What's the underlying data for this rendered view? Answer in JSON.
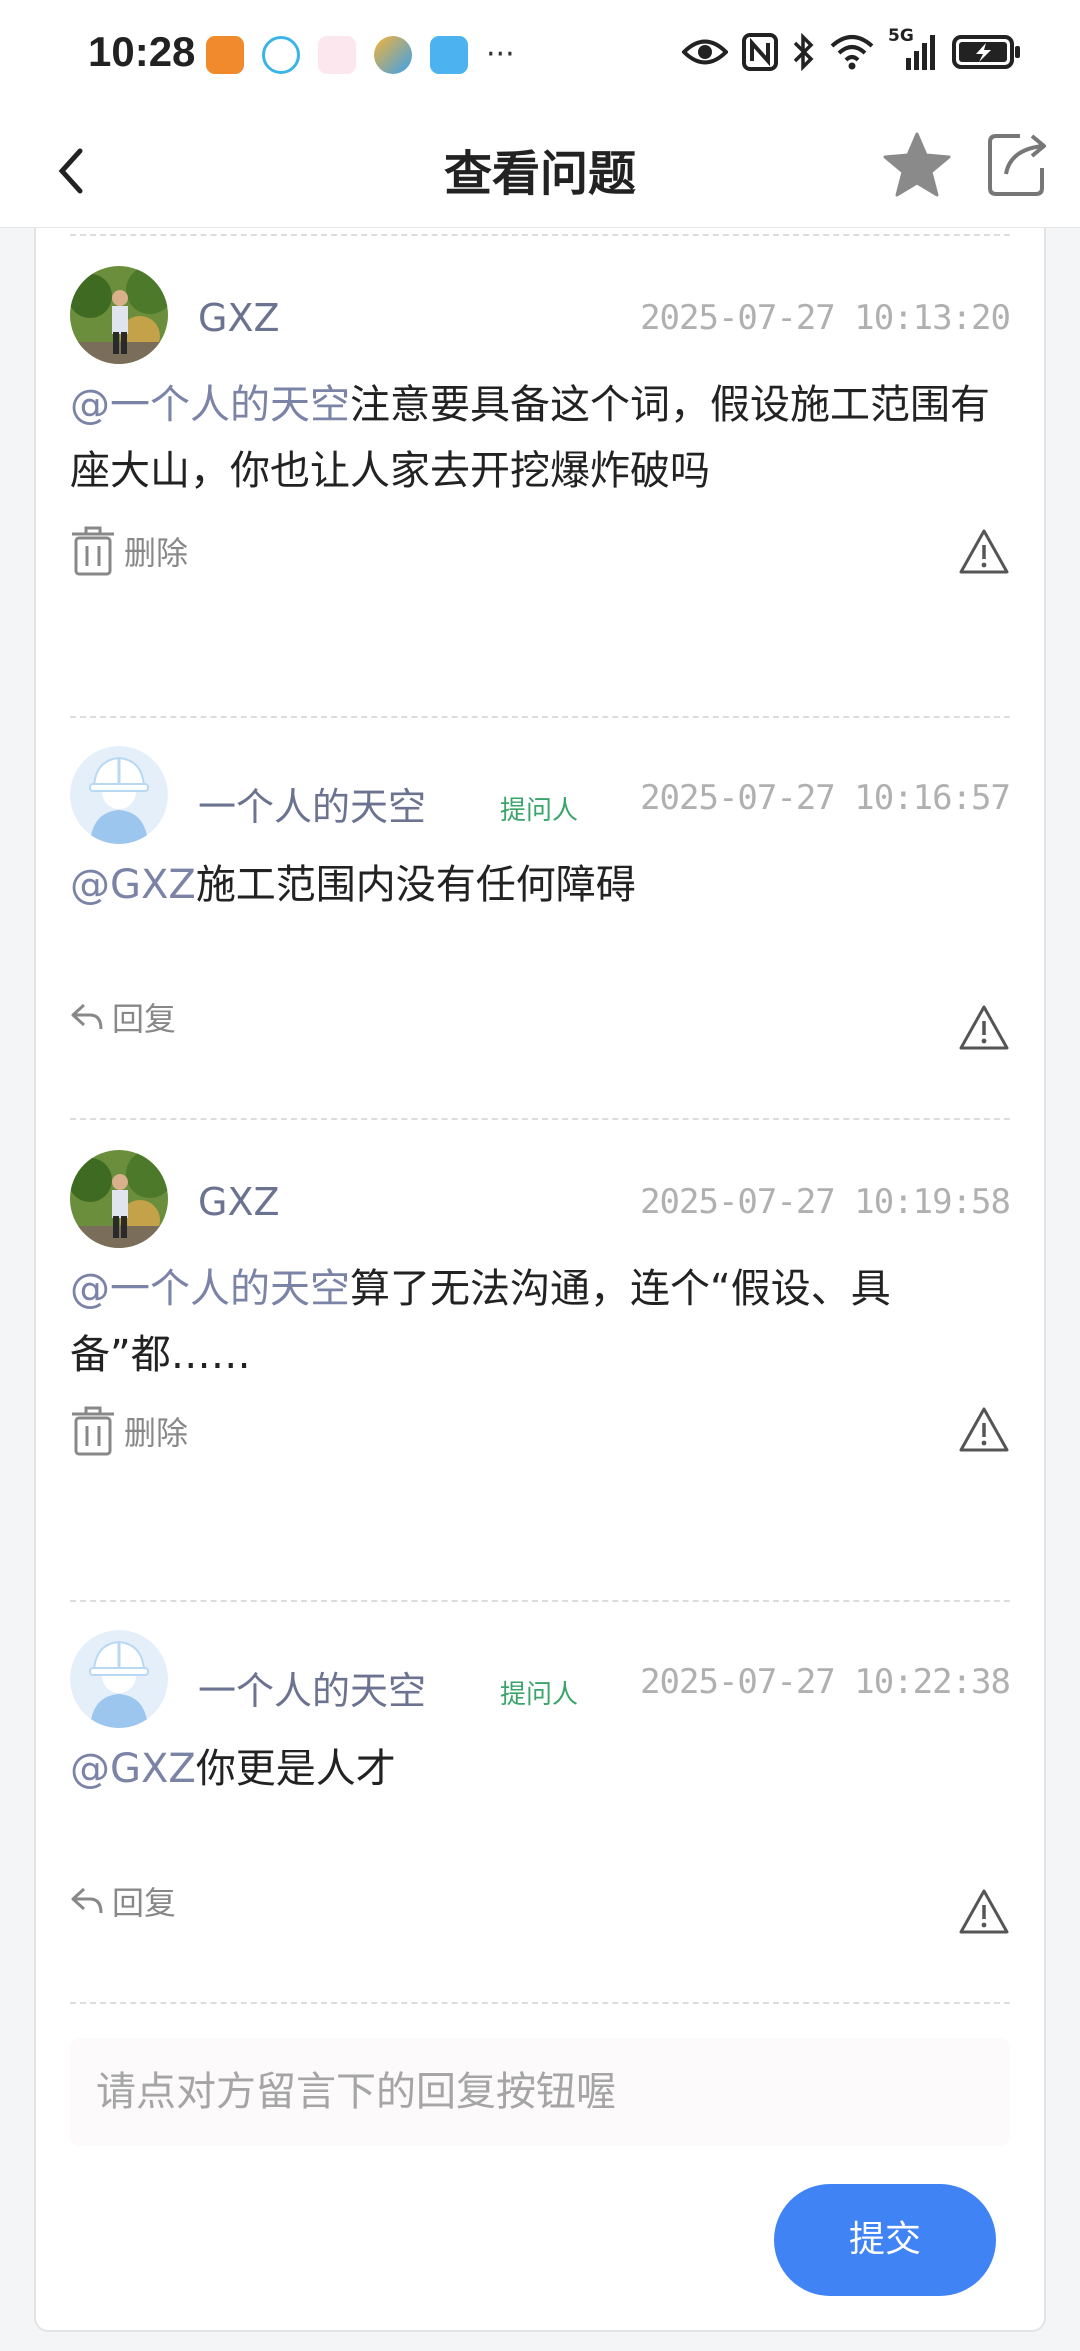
{
  "status_bar": {
    "time": "10:28",
    "more": "···",
    "network": "5G"
  },
  "nav": {
    "title": "查看问题",
    "icons": [
      "back-icon",
      "star-icon",
      "share-icon"
    ]
  },
  "comments": [
    {
      "user": "GXZ",
      "badge": "",
      "time": "2025-07-27 10:13:20",
      "mention": "@一个人的天空",
      "text": "注意要具备这个词，假设施工范围有座大山，你也让人家去开挖爆炸破吗",
      "action": "删除",
      "action_icon": "trash-icon",
      "avatar": "photo"
    },
    {
      "user": "一个人的天空",
      "badge": "提问人",
      "time": "2025-07-27 10:16:57",
      "mention": "@GXZ",
      "text": "施工范围内没有任何障碍",
      "action": "回复",
      "action_icon": "reply-icon",
      "avatar": "helmet"
    },
    {
      "user": "GXZ",
      "badge": "",
      "time": "2025-07-27 10:19:58",
      "mention": "@一个人的天空",
      "text": "算了无法沟通，连个“假设、具备”都……",
      "action": "删除",
      "action_icon": "trash-icon",
      "avatar": "photo"
    },
    {
      "user": "一个人的天空",
      "badge": "提问人",
      "time": "2025-07-27 10:22:38",
      "mention": "@GXZ",
      "text": "你更是人才",
      "action": "回复",
      "action_icon": "reply-icon",
      "avatar": "helmet"
    }
  ],
  "reply": {
    "placeholder": "请点对方留言下的回复按钮喔",
    "submit_label": "提交"
  },
  "colors": {
    "accent": "#3f83f4",
    "mention": "#7b83a6",
    "badge": "#3aa56a"
  }
}
